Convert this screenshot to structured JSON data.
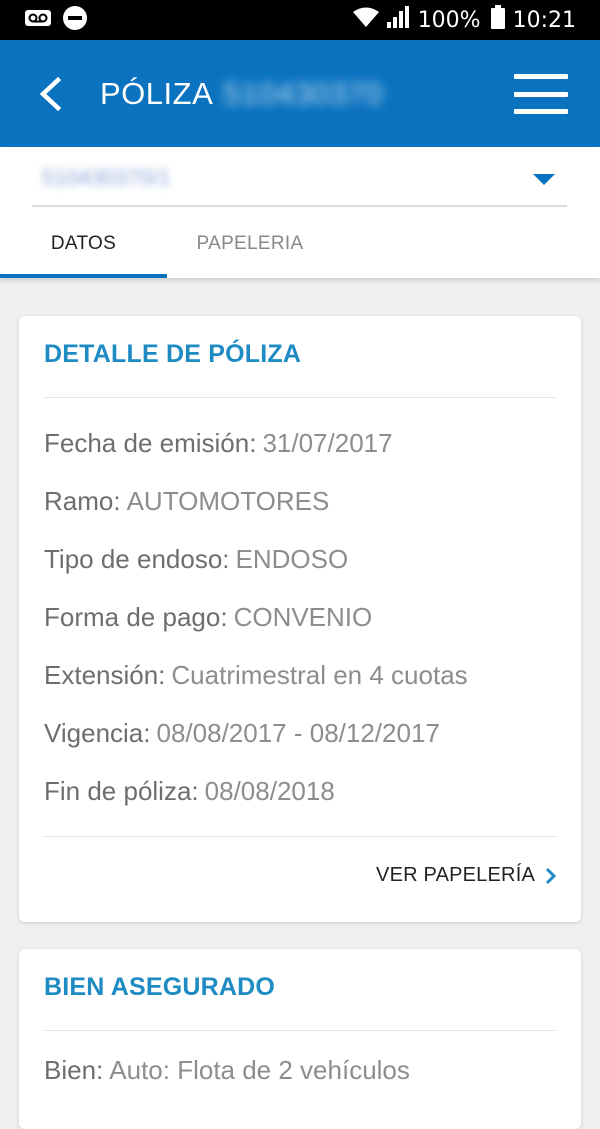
{
  "status_bar": {
    "battery_percent": "100%",
    "time": "10:21"
  },
  "app_bar": {
    "title": "PÓLIZA",
    "policy_number": "510430370"
  },
  "selector": {
    "value": "510430370/1"
  },
  "tabs": [
    {
      "label": "DATOS",
      "active": true
    },
    {
      "label": "PAPELERIA",
      "active": false
    }
  ],
  "policy_card": {
    "title": "DETALLE DE PÓLIZA",
    "rows": [
      {
        "label": "Fecha de emisión:",
        "value": "31/07/2017"
      },
      {
        "label": "Ramo:",
        "value": "AUTOMOTORES"
      },
      {
        "label": "Tipo de endoso:",
        "value": "ENDOSO"
      },
      {
        "label": "Forma de pago:",
        "value": "CONVENIO"
      },
      {
        "label": "Extensión:",
        "value": "Cuatrimestral en 4 cuotas"
      },
      {
        "label": "Vigencia:",
        "value": "08/08/2017 - 08/12/2017"
      },
      {
        "label": "Fin de póliza:",
        "value": "08/08/2018"
      }
    ],
    "link_label": "VER PAPELERÍA"
  },
  "insured_card": {
    "title": "BIEN ASEGURADO",
    "rows": [
      {
        "label": "Bien:",
        "value": "Auto: Flota de 2 vehículos"
      }
    ]
  },
  "colors": {
    "primary": "#0a72bf",
    "card_title": "#1e8bc3",
    "background": "#efefef"
  },
  "icons": {
    "status_left": [
      "voicemail-icon",
      "do-not-disturb-icon"
    ],
    "status_right": [
      "wifi-icon",
      "signal-icon",
      "battery-icon"
    ],
    "app_bar": [
      "back-arrow-icon",
      "menu-icon"
    ],
    "link": "chevron-right-icon"
  }
}
